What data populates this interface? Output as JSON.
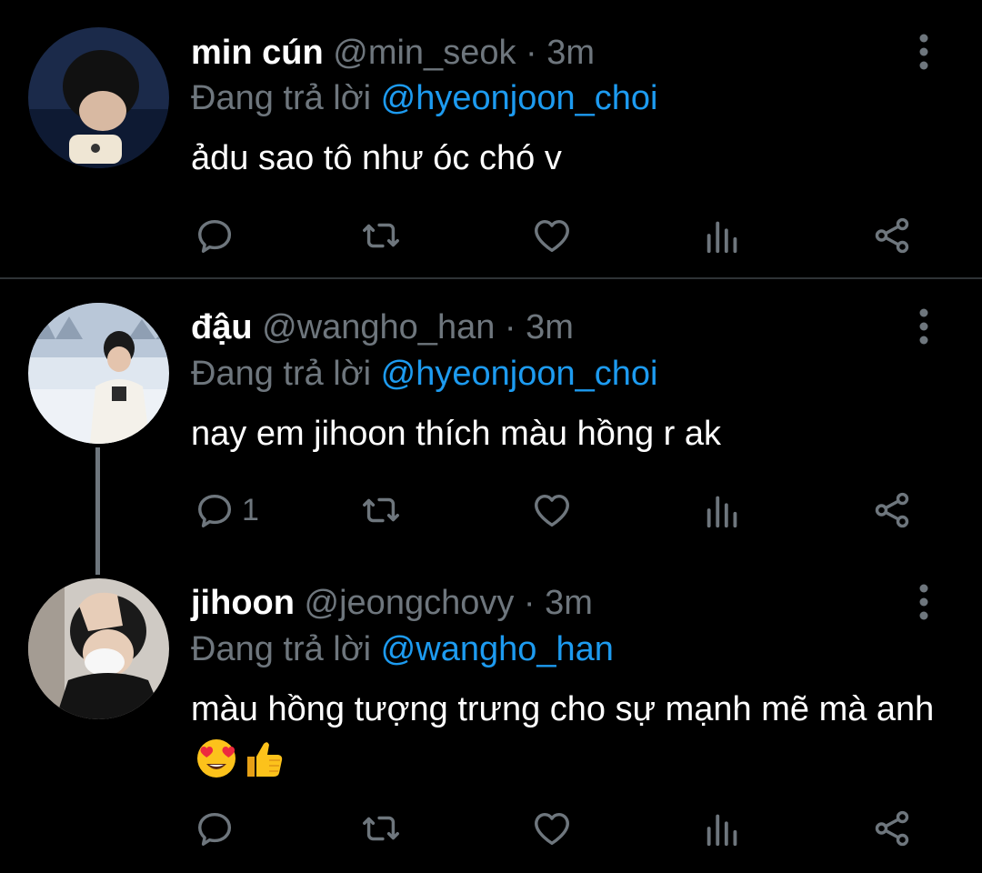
{
  "tweets": [
    {
      "name": "min cún",
      "handle": "@min_seok",
      "dot": "·",
      "time": "3m",
      "reply_prefix": "Đang trả lời",
      "reply_to": "@hyeonjoon_choi",
      "text": "ảdu sao tô như óc chó v",
      "reply_count": ""
    },
    {
      "name": "đậu",
      "handle": "@wangho_han",
      "dot": "·",
      "time": "3m",
      "reply_prefix": "Đang trả lời",
      "reply_to": "@hyeonjoon_choi",
      "text": "nay em jihoon thích màu hồng r ak",
      "reply_count": "1"
    },
    {
      "name": "jihoon",
      "handle": "@jeongchovy",
      "dot": "·",
      "time": "3m",
      "reply_prefix": "Đang trả lời",
      "reply_to": "@wangho_han",
      "text": "màu hồng tượng trưng cho sự mạnh mẽ mà anh",
      "emojis": [
        "heart-eyes-emoji",
        "thumbs-up-emoji"
      ],
      "reply_count": ""
    }
  ],
  "icons": {
    "reply": "reply-icon",
    "retweet": "retweet-icon",
    "like": "like-icon",
    "analytics": "analytics-icon",
    "share": "share-icon",
    "more": "more-vertical-icon"
  },
  "colors": {
    "background": "#000000",
    "text": "#ffffff",
    "muted": "#6e767d",
    "mention": "#1d9bf0",
    "divider": "#2f3336"
  }
}
